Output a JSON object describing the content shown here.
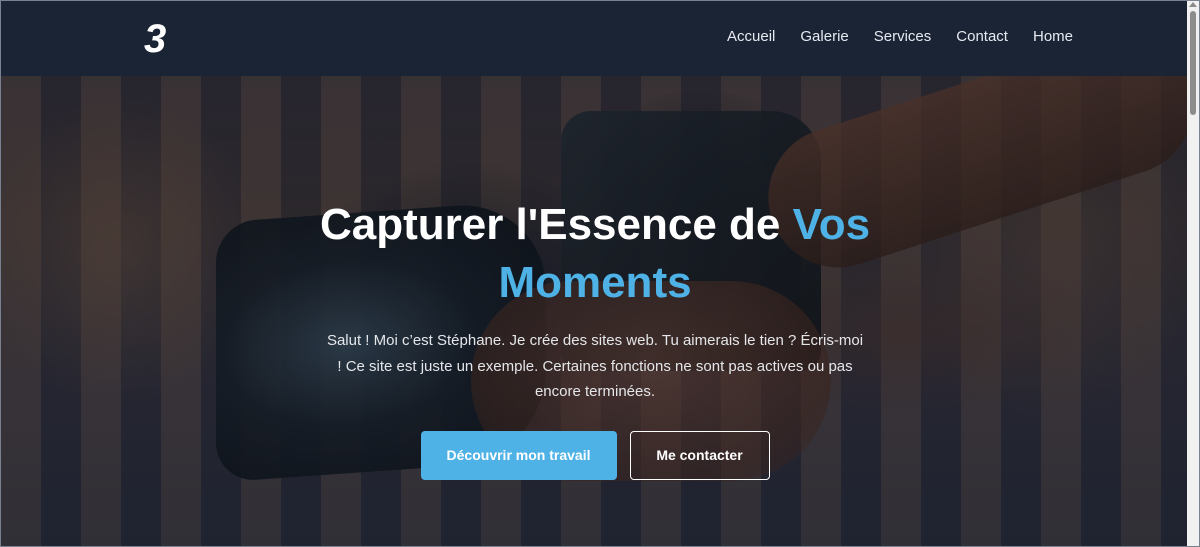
{
  "logo": {
    "text": "3"
  },
  "nav": {
    "items": [
      {
        "label": "Accueil"
      },
      {
        "label": "Galerie"
      },
      {
        "label": "Services"
      },
      {
        "label": "Contact"
      },
      {
        "label": "Home"
      }
    ]
  },
  "hero": {
    "headline_main": "Capturer l'Essence de ",
    "headline_accent": "Vos Moments",
    "intro": "Salut ! Moi c’est Stéphane. Je crée des sites web. Tu aimerais le tien ? Écris-moi ! Ce site est juste un exemple. Certaines fonctions ne sont pas actives ou pas encore terminées.",
    "primary_button": "Découvrir mon travail",
    "secondary_button": "Me contacter"
  },
  "colors": {
    "accent": "#4fb2e6",
    "navbar": "#1b2435"
  }
}
